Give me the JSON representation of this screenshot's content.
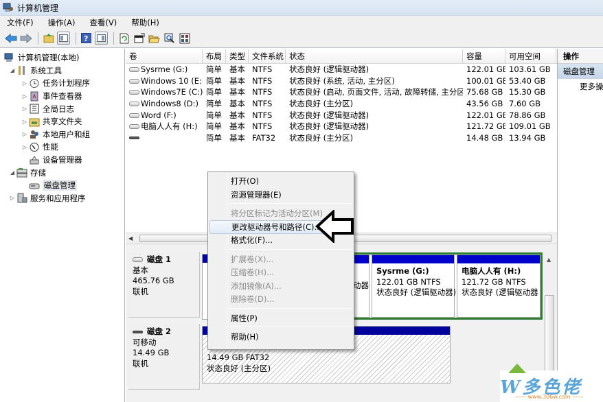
{
  "window": {
    "title": "计算机管理"
  },
  "menu": [
    "文件(F)",
    "操作(A)",
    "查看(V)",
    "帮助(H)"
  ],
  "toolbar": {
    "icons": [
      "back-arrow-icon",
      "forward-arrow-icon",
      "up-folder-icon",
      "show-hide-tree-icon",
      "help-icon",
      "show-hide-action-pane-icon",
      "refresh-icon",
      "properties-icon",
      "open-folder-icon",
      "search-icon",
      "console-icon"
    ]
  },
  "tree": {
    "root": "计算机管理(本地)",
    "items": [
      {
        "label": "系统工具",
        "level": 1,
        "expanded": true
      },
      {
        "label": "任务计划程序",
        "level": 2
      },
      {
        "label": "事件查看器",
        "level": 2
      },
      {
        "label": "全局日志",
        "level": 2
      },
      {
        "label": "共享文件夹",
        "level": 2
      },
      {
        "label": "本地用户和组",
        "level": 2
      },
      {
        "label": "性能",
        "level": 2
      },
      {
        "label": "设备管理器",
        "level": 2
      },
      {
        "label": "存储",
        "level": 1,
        "expanded": true
      },
      {
        "label": "磁盘管理",
        "level": 2,
        "selected": true
      },
      {
        "label": "服务和应用程序",
        "level": 1
      }
    ]
  },
  "volumes": {
    "columns": [
      "卷",
      "布局",
      "类型",
      "文件系统",
      "状态",
      "容量",
      "可用空间"
    ],
    "rows": [
      {
        "name": "Sysrme (G:)",
        "layout": "简单",
        "type": "基本",
        "fs": "NTFS",
        "status": "状态良好 (逻辑驱动器)",
        "capacity": "122.01 GB",
        "free": "103.61 GB"
      },
      {
        "name": "Windows 10 (E:)",
        "layout": "简单",
        "type": "基本",
        "fs": "NTFS",
        "status": "状态良好 (系统, 活动, 主分区)",
        "capacity": "100.01 GB",
        "free": "53.40 GB"
      },
      {
        "name": "Windows7E (C:)",
        "layout": "简单",
        "type": "基本",
        "fs": "NTFS",
        "status": "状态良好 (启动, 页面文件, 活动, 故障转储, 主分区)",
        "capacity": "75.68 GB",
        "free": "15.30 GB"
      },
      {
        "name": "Windows8 (D:)",
        "layout": "简单",
        "type": "基本",
        "fs": "NTFS",
        "status": "状态良好 (主分区)",
        "capacity": "43.56 GB",
        "free": "7.60 GB"
      },
      {
        "name": "Word (F:)",
        "layout": "简单",
        "type": "基本",
        "fs": "NTFS",
        "status": "状态良好 (逻辑驱动器)",
        "capacity": "122.01 GB",
        "free": "78.86 GB"
      },
      {
        "name": "电脑人人有 (H:)",
        "layout": "简单",
        "type": "基本",
        "fs": "NTFS",
        "status": "状态良好 (逻辑驱动器)",
        "capacity": "121.72 GB",
        "free": "109.01 GB"
      },
      {
        "name": "",
        "layout": "简单",
        "type": "基本",
        "fs": "FAT32",
        "status": "状态良好 (主分区)",
        "capacity": "14.48 GB",
        "free": "13.94 GB"
      }
    ]
  },
  "disks": [
    {
      "name": "磁盘 1",
      "kind": "基本",
      "size": "465.76 GB",
      "state": "联机",
      "partitions": [
        {
          "label": "Sysrme  (G:)",
          "size_fs": "122.01 GB NTFS",
          "status": "状态良好 (逻辑驱动器)"
        },
        {
          "label": "电脑人人有  (H:)",
          "size_fs": "121.72 GB NTFS",
          "status": "状态良好 (逻辑驱动器"
        }
      ],
      "partial_text": "动器"
    },
    {
      "name": "磁盘 2",
      "kind": "可移动",
      "size": "14.49 GB",
      "state": "联机",
      "partitions": [
        {
          "label": "",
          "size_fs": "14.49 GB FAT32",
          "status": "状态良好 (主分区)"
        }
      ]
    }
  ],
  "actions": {
    "header": "操作",
    "section": "磁盘管理",
    "more": "更多操作"
  },
  "context_menu": {
    "items": [
      {
        "label": "打开(O)",
        "enabled": true
      },
      {
        "label": "资源管理器(E)",
        "enabled": true
      },
      {
        "separator": true
      },
      {
        "label": "将分区标记为活动分区(M)",
        "enabled": false
      },
      {
        "label": "更改驱动器号和路径(C)...",
        "enabled": true,
        "highlighted": true
      },
      {
        "label": "格式化(F)...",
        "enabled": true
      },
      {
        "separator": true
      },
      {
        "label": "扩展卷(X)...",
        "enabled": false
      },
      {
        "label": "压缩卷(H)...",
        "enabled": false
      },
      {
        "label": "添加镜像(A)...",
        "enabled": false
      },
      {
        "label": "删除卷(D)...",
        "enabled": false
      },
      {
        "separator": true
      },
      {
        "label": "属性(P)",
        "enabled": true
      },
      {
        "separator": true
      },
      {
        "label": "帮助(H)",
        "enabled": true
      }
    ]
  },
  "watermark": {
    "logo": "W多色佬",
    "url": "—— www.306w.com ——"
  },
  "colors": {
    "partition_bar": "#00009c",
    "extended_border": "#2f7d32",
    "selection": "#c5d5e8"
  }
}
